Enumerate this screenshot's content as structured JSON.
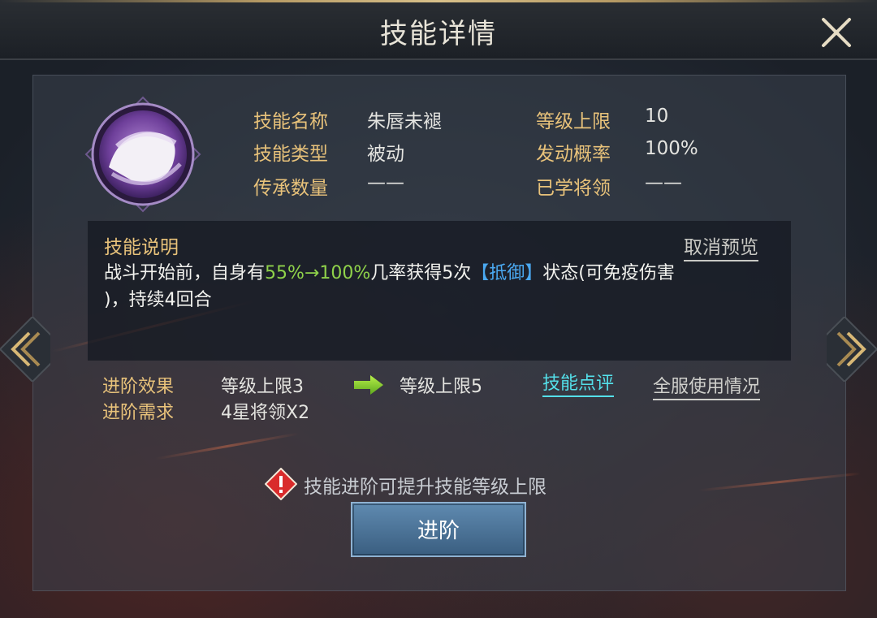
{
  "header": {
    "title": "技能详情"
  },
  "skill": {
    "rows": [
      {
        "label": "技能名称",
        "value": "朱唇未褪"
      },
      {
        "label": "技能类型",
        "value": "被动"
      },
      {
        "label": "传承数量",
        "value": "——"
      }
    ],
    "rows_right": [
      {
        "label": "等级上限",
        "value": "10"
      },
      {
        "label": "发动概率",
        "value": "100%"
      },
      {
        "label": "已学将领",
        "value": "——"
      }
    ]
  },
  "description": {
    "title": "技能说明",
    "cancel_preview": "取消预览",
    "part1": "战斗开始前，自身有",
    "chance": "55%→100%",
    "part2": "几率获得5次",
    "status": "【抵御】",
    "part3": "状态(可免疫伤害",
    "line2": ")，持续4回合"
  },
  "advancement": {
    "effect_label": "进阶效果",
    "effect_from": "等级上限3",
    "effect_to": "等级上限5",
    "need_label": "进阶需求",
    "need_value": "4星将领X2",
    "review_link": "技能点评",
    "usage_link": "全服使用情况"
  },
  "notice": {
    "text": "技能进阶可提升技能等级上限"
  },
  "buttons": {
    "advance": "进阶"
  },
  "colors": {
    "label": "#e8c27a",
    "highlight_green": "#8fd24a",
    "highlight_blue": "#4aa8f0",
    "link_cyan": "#54e0ea"
  }
}
